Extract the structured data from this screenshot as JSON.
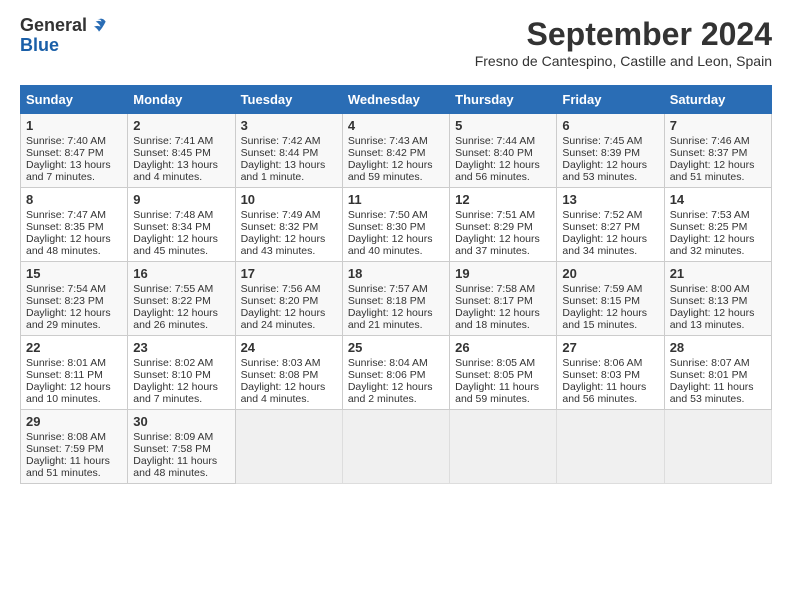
{
  "header": {
    "logo_line1": "General",
    "logo_line2": "Blue",
    "title": "September 2024",
    "subtitle": "Fresno de Cantespino, Castille and Leon, Spain"
  },
  "weekdays": [
    "Sunday",
    "Monday",
    "Tuesday",
    "Wednesday",
    "Thursday",
    "Friday",
    "Saturday"
  ],
  "weeks": [
    [
      {
        "day": "1",
        "lines": [
          "Sunrise: 7:40 AM",
          "Sunset: 8:47 PM",
          "Daylight: 13 hours",
          "and 7 minutes."
        ]
      },
      {
        "day": "2",
        "lines": [
          "Sunrise: 7:41 AM",
          "Sunset: 8:45 PM",
          "Daylight: 13 hours",
          "and 4 minutes."
        ]
      },
      {
        "day": "3",
        "lines": [
          "Sunrise: 7:42 AM",
          "Sunset: 8:44 PM",
          "Daylight: 13 hours",
          "and 1 minute."
        ]
      },
      {
        "day": "4",
        "lines": [
          "Sunrise: 7:43 AM",
          "Sunset: 8:42 PM",
          "Daylight: 12 hours",
          "and 59 minutes."
        ]
      },
      {
        "day": "5",
        "lines": [
          "Sunrise: 7:44 AM",
          "Sunset: 8:40 PM",
          "Daylight: 12 hours",
          "and 56 minutes."
        ]
      },
      {
        "day": "6",
        "lines": [
          "Sunrise: 7:45 AM",
          "Sunset: 8:39 PM",
          "Daylight: 12 hours",
          "and 53 minutes."
        ]
      },
      {
        "day": "7",
        "lines": [
          "Sunrise: 7:46 AM",
          "Sunset: 8:37 PM",
          "Daylight: 12 hours",
          "and 51 minutes."
        ]
      }
    ],
    [
      {
        "day": "8",
        "lines": [
          "Sunrise: 7:47 AM",
          "Sunset: 8:35 PM",
          "Daylight: 12 hours",
          "and 48 minutes."
        ]
      },
      {
        "day": "9",
        "lines": [
          "Sunrise: 7:48 AM",
          "Sunset: 8:34 PM",
          "Daylight: 12 hours",
          "and 45 minutes."
        ]
      },
      {
        "day": "10",
        "lines": [
          "Sunrise: 7:49 AM",
          "Sunset: 8:32 PM",
          "Daylight: 12 hours",
          "and 43 minutes."
        ]
      },
      {
        "day": "11",
        "lines": [
          "Sunrise: 7:50 AM",
          "Sunset: 8:30 PM",
          "Daylight: 12 hours",
          "and 40 minutes."
        ]
      },
      {
        "day": "12",
        "lines": [
          "Sunrise: 7:51 AM",
          "Sunset: 8:29 PM",
          "Daylight: 12 hours",
          "and 37 minutes."
        ]
      },
      {
        "day": "13",
        "lines": [
          "Sunrise: 7:52 AM",
          "Sunset: 8:27 PM",
          "Daylight: 12 hours",
          "and 34 minutes."
        ]
      },
      {
        "day": "14",
        "lines": [
          "Sunrise: 7:53 AM",
          "Sunset: 8:25 PM",
          "Daylight: 12 hours",
          "and 32 minutes."
        ]
      }
    ],
    [
      {
        "day": "15",
        "lines": [
          "Sunrise: 7:54 AM",
          "Sunset: 8:23 PM",
          "Daylight: 12 hours",
          "and 29 minutes."
        ]
      },
      {
        "day": "16",
        "lines": [
          "Sunrise: 7:55 AM",
          "Sunset: 8:22 PM",
          "Daylight: 12 hours",
          "and 26 minutes."
        ]
      },
      {
        "day": "17",
        "lines": [
          "Sunrise: 7:56 AM",
          "Sunset: 8:20 PM",
          "Daylight: 12 hours",
          "and 24 minutes."
        ]
      },
      {
        "day": "18",
        "lines": [
          "Sunrise: 7:57 AM",
          "Sunset: 8:18 PM",
          "Daylight: 12 hours",
          "and 21 minutes."
        ]
      },
      {
        "day": "19",
        "lines": [
          "Sunrise: 7:58 AM",
          "Sunset: 8:17 PM",
          "Daylight: 12 hours",
          "and 18 minutes."
        ]
      },
      {
        "day": "20",
        "lines": [
          "Sunrise: 7:59 AM",
          "Sunset: 8:15 PM",
          "Daylight: 12 hours",
          "and 15 minutes."
        ]
      },
      {
        "day": "21",
        "lines": [
          "Sunrise: 8:00 AM",
          "Sunset: 8:13 PM",
          "Daylight: 12 hours",
          "and 13 minutes."
        ]
      }
    ],
    [
      {
        "day": "22",
        "lines": [
          "Sunrise: 8:01 AM",
          "Sunset: 8:11 PM",
          "Daylight: 12 hours",
          "and 10 minutes."
        ]
      },
      {
        "day": "23",
        "lines": [
          "Sunrise: 8:02 AM",
          "Sunset: 8:10 PM",
          "Daylight: 12 hours",
          "and 7 minutes."
        ]
      },
      {
        "day": "24",
        "lines": [
          "Sunrise: 8:03 AM",
          "Sunset: 8:08 PM",
          "Daylight: 12 hours",
          "and 4 minutes."
        ]
      },
      {
        "day": "25",
        "lines": [
          "Sunrise: 8:04 AM",
          "Sunset: 8:06 PM",
          "Daylight: 12 hours",
          "and 2 minutes."
        ]
      },
      {
        "day": "26",
        "lines": [
          "Sunrise: 8:05 AM",
          "Sunset: 8:05 PM",
          "Daylight: 11 hours",
          "and 59 minutes."
        ]
      },
      {
        "day": "27",
        "lines": [
          "Sunrise: 8:06 AM",
          "Sunset: 8:03 PM",
          "Daylight: 11 hours",
          "and 56 minutes."
        ]
      },
      {
        "day": "28",
        "lines": [
          "Sunrise: 8:07 AM",
          "Sunset: 8:01 PM",
          "Daylight: 11 hours",
          "and 53 minutes."
        ]
      }
    ],
    [
      {
        "day": "29",
        "lines": [
          "Sunrise: 8:08 AM",
          "Sunset: 7:59 PM",
          "Daylight: 11 hours",
          "and 51 minutes."
        ]
      },
      {
        "day": "30",
        "lines": [
          "Sunrise: 8:09 AM",
          "Sunset: 7:58 PM",
          "Daylight: 11 hours",
          "and 48 minutes."
        ]
      },
      {
        "day": "",
        "lines": []
      },
      {
        "day": "",
        "lines": []
      },
      {
        "day": "",
        "lines": []
      },
      {
        "day": "",
        "lines": []
      },
      {
        "day": "",
        "lines": []
      }
    ]
  ]
}
